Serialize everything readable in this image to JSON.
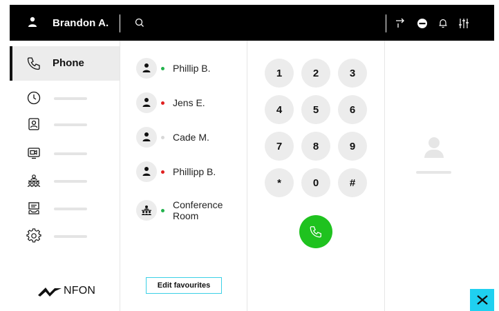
{
  "header": {
    "user_name": "Brandon A.",
    "icons": [
      "user-icon",
      "search-icon",
      "call-forward-icon",
      "do-not-disturb-icon",
      "bell-icon",
      "sliders-icon"
    ]
  },
  "sidebar": {
    "active_label": "Phone",
    "items": [
      {
        "icon": "phone-icon",
        "label": "Phone"
      },
      {
        "icon": "clock-icon"
      },
      {
        "icon": "contacts-icon"
      },
      {
        "icon": "video-icon"
      },
      {
        "icon": "conference-icon"
      },
      {
        "icon": "voicemail-icon"
      },
      {
        "icon": "settings-icon"
      }
    ],
    "logo_text": "NFON"
  },
  "favourites": {
    "items": [
      {
        "name": "Phillip B.",
        "status": "online",
        "status_color": "#22b24c"
      },
      {
        "name": "Jens E.",
        "status": "busy",
        "status_color": "#e02020"
      },
      {
        "name": "Cade M.",
        "status": "offline",
        "status_color": "#d8d8d8"
      },
      {
        "name": "Phillipp B.",
        "status": "busy",
        "status_color": "#e02020"
      },
      {
        "name": "Conference Room",
        "status": "online",
        "status_color": "#22b24c"
      }
    ],
    "edit_label": "Edit favourites"
  },
  "dialpad": {
    "keys": [
      "1",
      "2",
      "3",
      "4",
      "5",
      "6",
      "7",
      "8",
      "9",
      "*",
      "0",
      "#"
    ],
    "call_color": "#1fc21f"
  },
  "colors": {
    "accent": "#1fd0f0",
    "call": "#1fc21f",
    "topbar": "#000000"
  }
}
